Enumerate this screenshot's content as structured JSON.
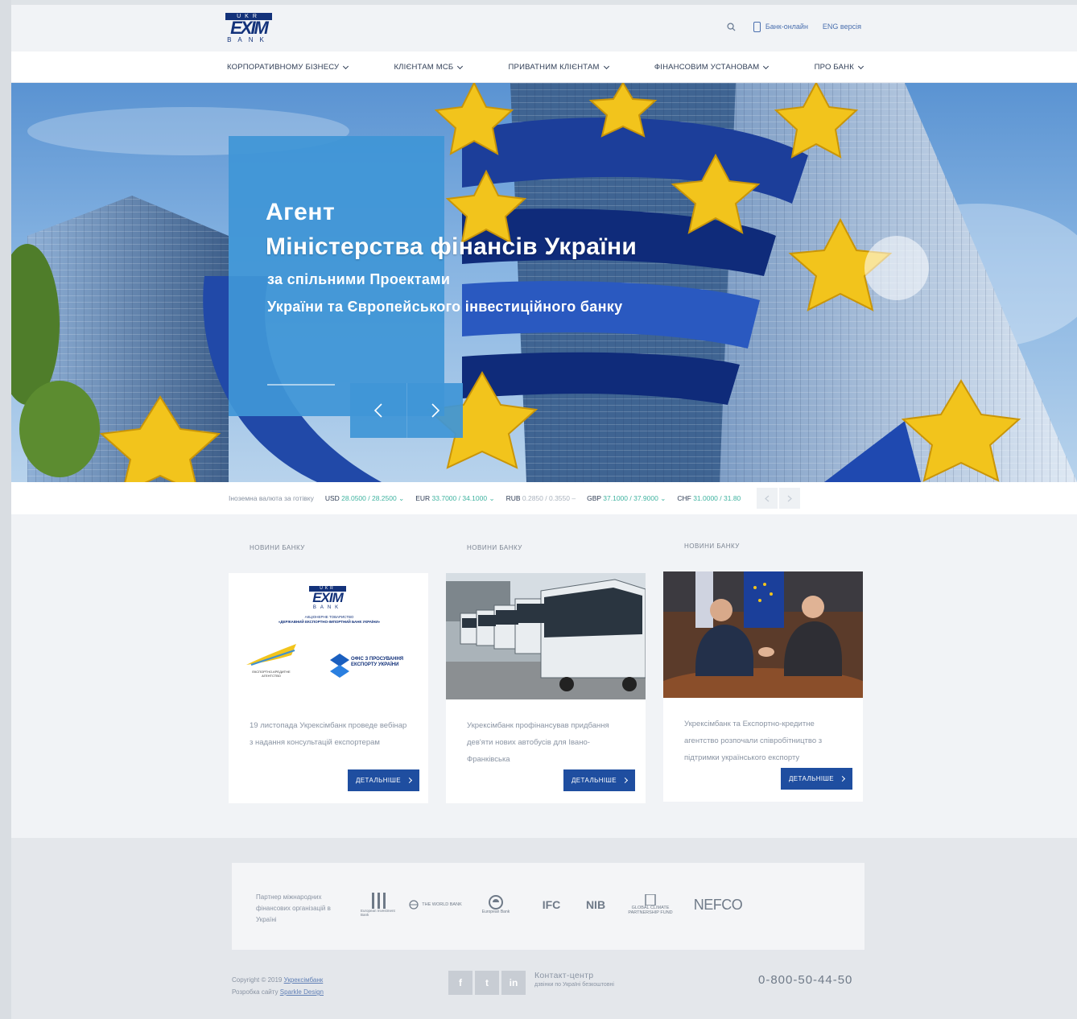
{
  "header": {
    "logo": {
      "top": "UKR",
      "middle": "EXIM",
      "bottom": "BANK"
    },
    "online_label": "Банк-онлайн",
    "lang_label": "ENG версія"
  },
  "nav": {
    "items": [
      {
        "label": "КОРПОРАТИВНОМУ БІЗНЕСУ"
      },
      {
        "label": "КЛІЄНТАМ МСБ"
      },
      {
        "label": "ПРИВАТНИМ КЛІЄНТАМ"
      },
      {
        "label": "ФІНАНСОВИМ УСТАНОВАМ"
      },
      {
        "label": "ПРО БАНК"
      }
    ]
  },
  "hero": {
    "title_line1": "Агент",
    "title_line2": "Міністерства фінансів України",
    "subtitle_line1": "за спільними Проектами",
    "subtitle_line2": "України та Європейського інвестиційного банку"
  },
  "rates": {
    "label": "Іноземна валюта за готівку",
    "items": [
      {
        "code": "USD",
        "value": "28.0500 / 28.2500",
        "trend": "down"
      },
      {
        "code": "EUR",
        "value": "33.7000 / 34.1000",
        "trend": "down"
      },
      {
        "code": "RUB",
        "value": "0.2850 / 0.3550",
        "trend": "flat"
      },
      {
        "code": "GBP",
        "value": "37.1000 / 37.9000",
        "trend": "down"
      },
      {
        "code": "CHF",
        "value": "31.0000 / 31.80",
        "trend": "flat"
      }
    ]
  },
  "news": {
    "items": [
      {
        "label": "НОВИНИ БАНКУ",
        "text": "19 листопада Укрексімбанк проведе вебінар з надання консультацій експортерам",
        "button": "ДЕТАЛЬНІШЕ"
      },
      {
        "label": "НОВИНИ БАНКУ",
        "text": "Укрексімбанк профінансував придбання дев'яти нових автобусів для Івано-Франківська",
        "button": "ДЕТАЛЬНІШЕ"
      },
      {
        "label": "НОВИНИ БАНКУ",
        "text": "Укрексімбанк та Експортно-кредитне агентство розпочали співробітництво з підтримки українського експорту",
        "button": "ДЕТАЛЬНІШЕ"
      }
    ],
    "card1_logo": {
      "top": "UKR",
      "middle": "EXIM",
      "bottom": "BANK",
      "org": "АКЦІОНЕРНЕ ТОВАРИСТВО",
      "org_name": "«ДЕРЖАВНИЙ ЕКСПОРТНО-ІМПОРТНИЙ БАНК УКРАЇНИ»",
      "eca": "ЕКСПОРТНО-КРЕДИТНЕ АГЕНТСТВО",
      "office": "ОФІС З ПРОСУВАННЯ ЕКСПОРТУ УКРАЇНИ"
    }
  },
  "partners": {
    "label": "Партнер міжнародних фінансових організацій в Україні",
    "logos": [
      {
        "name": "European Investment Bank",
        "short": "EIB"
      },
      {
        "name": "THE WORLD BANK",
        "short": "THE WORLD BANK"
      },
      {
        "name": "European Bank",
        "short": "EBRD"
      },
      {
        "name": "IFC",
        "short": "IFC"
      },
      {
        "name": "NIB",
        "short": "NIB"
      },
      {
        "name": "GLOBAL CLIMATE PARTNERSHIP FUND",
        "short": "GLOBAL CLIMATE"
      },
      {
        "name": "NEFCO",
        "short": "NEFCO"
      }
    ]
  },
  "footer": {
    "copyright_prefix": "Copyright © 2019",
    "copyright_link": "Укрексімбанк",
    "dev_prefix": "Розробка сайту",
    "dev_link": "Sparkle Design",
    "contact_title": "Контакт-центр",
    "contact_sub": "дзвінки по Україні безкоштовні",
    "phone": "0-800-50-44-50",
    "social": [
      "f",
      "t",
      "in"
    ]
  }
}
